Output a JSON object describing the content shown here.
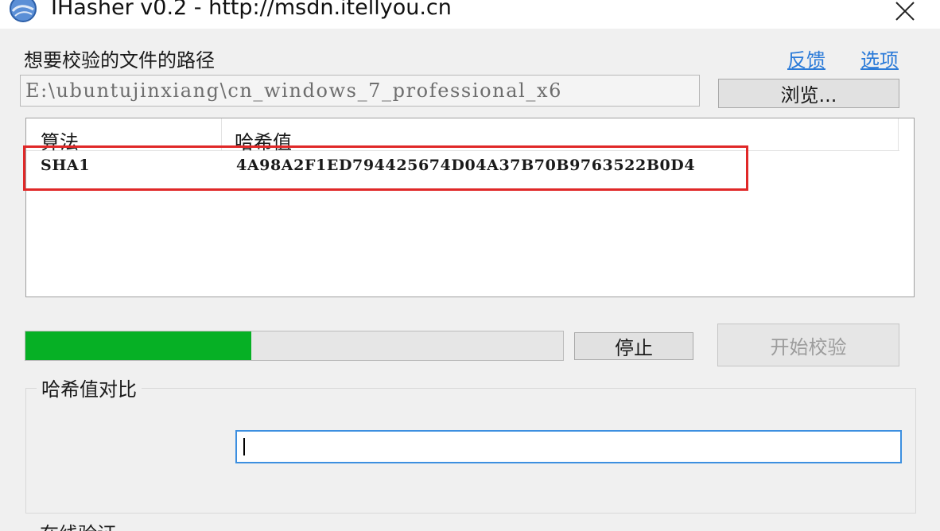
{
  "window": {
    "title": "IHasher v0.2 - http://msdn.itellyou.cn",
    "icon": "app-globe-icon",
    "close_icon": "close-icon"
  },
  "path_section": {
    "label": "想要校验的文件的路径",
    "feedback_link": "反馈",
    "options_link": "选项",
    "path_value": "E:\\ubuntujinxiang\\cn_windows_7_professional_x6",
    "browse_button": "浏览..."
  },
  "results": {
    "columns": [
      "算法",
      "哈希值"
    ],
    "rows": [
      {
        "algorithm": "SHA1",
        "hash": "4A98A2F1ED794425674D04A37B70B9763522B0D4"
      }
    ],
    "highlight_color": "#e02828"
  },
  "progress": {
    "fraction": 0.42,
    "color": "#06b025",
    "stop_button": "停止",
    "verify_button": "开始校验"
  },
  "compare": {
    "group_title": "哈希值对比",
    "input_value": ""
  },
  "next_group": {
    "title": "在线验证"
  }
}
